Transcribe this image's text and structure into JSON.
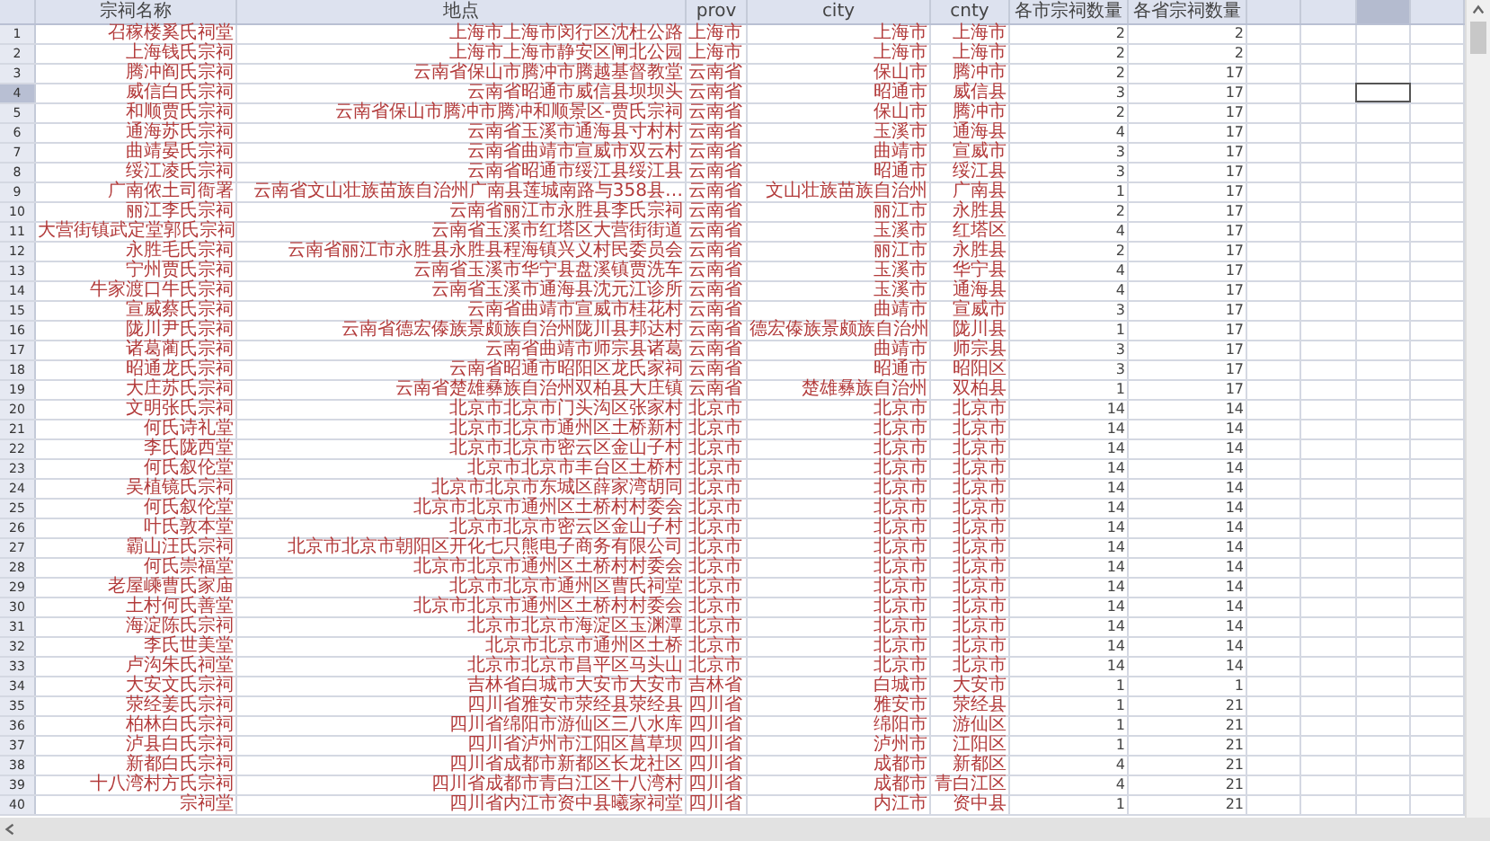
{
  "columns": [
    "宗祠名称",
    "地点",
    "prov",
    "city",
    "cnty",
    "各市宗祠数量",
    "各省宗祠数量"
  ],
  "empty_columns": [
    {
      "selected": false
    },
    {
      "selected": false
    },
    {
      "selected": true
    },
    {
      "selected": false
    }
  ],
  "rows": [
    {
      "number": "1",
      "selected": false,
      "cells": [
        "召稼楼奚氏祠堂",
        "上海市上海市闵行区沈杜公路",
        "上海市",
        "上海市",
        "上海市",
        "2",
        "2"
      ]
    },
    {
      "number": "2",
      "selected": false,
      "cells": [
        "上海钱氏宗祠",
        "上海市上海市静安区闸北公园",
        "上海市",
        "上海市",
        "上海市",
        "2",
        "2"
      ]
    },
    {
      "number": "3",
      "selected": false,
      "cells": [
        "腾冲阎氏宗祠",
        "云南省保山市腾冲市腾越基督教堂",
        "云南省",
        "保山市",
        "腾冲市",
        "2",
        "17"
      ]
    },
    {
      "number": "4",
      "selected": true,
      "cells": [
        "威信白氏宗祠",
        "云南省昭通市威信县坝坝头",
        "云南省",
        "昭通市",
        "威信县",
        "3",
        "17"
      ]
    },
    {
      "number": "5",
      "selected": false,
      "cells": [
        "和顺贾氏宗祠",
        "云南省保山市腾冲市腾冲和顺景区-贾氏宗祠",
        "云南省",
        "保山市",
        "腾冲市",
        "2",
        "17"
      ]
    },
    {
      "number": "6",
      "selected": false,
      "cells": [
        "通海苏氏宗祠",
        "云南省玉溪市通海县寸村村",
        "云南省",
        "玉溪市",
        "通海县",
        "4",
        "17"
      ]
    },
    {
      "number": "7",
      "selected": false,
      "cells": [
        "曲靖晏氏宗祠",
        "云南省曲靖市宣威市双云村",
        "云南省",
        "曲靖市",
        "宣威市",
        "3",
        "17"
      ]
    },
    {
      "number": "8",
      "selected": false,
      "cells": [
        "绥江凌氏宗祠",
        "云南省昭通市绥江县绥江县",
        "云南省",
        "昭通市",
        "绥江县",
        "3",
        "17"
      ]
    },
    {
      "number": "9",
      "selected": false,
      "cells": [
        "广南侬土司衙署",
        "云南省文山壮族苗族自治州广南县莲城南路与358县…",
        "云南省",
        "文山壮族苗族自治州",
        "广南县",
        "1",
        "17"
      ]
    },
    {
      "number": "10",
      "selected": false,
      "cells": [
        "丽江李氏宗祠",
        "云南省丽江市永胜县李氏宗祠",
        "云南省",
        "丽江市",
        "永胜县",
        "2",
        "17"
      ]
    },
    {
      "number": "11",
      "selected": false,
      "cells": [
        "大营街镇武定堂郭氏宗祠",
        "云南省玉溪市红塔区大营街街道",
        "云南省",
        "玉溪市",
        "红塔区",
        "4",
        "17"
      ]
    },
    {
      "number": "12",
      "selected": false,
      "cells": [
        "永胜毛氏宗祠",
        "云南省丽江市永胜县永胜县程海镇兴义村民委员会",
        "云南省",
        "丽江市",
        "永胜县",
        "2",
        "17"
      ]
    },
    {
      "number": "13",
      "selected": false,
      "cells": [
        "宁州贾氏宗祠",
        "云南省玉溪市华宁县盘溪镇贾洗车",
        "云南省",
        "玉溪市",
        "华宁县",
        "4",
        "17"
      ]
    },
    {
      "number": "14",
      "selected": false,
      "cells": [
        "牛家渡口牛氏宗祠",
        "云南省玉溪市通海县沈元江诊所",
        "云南省",
        "玉溪市",
        "通海县",
        "4",
        "17"
      ]
    },
    {
      "number": "15",
      "selected": false,
      "cells": [
        "宣威蔡氏宗祠",
        "云南省曲靖市宣威市桂花村",
        "云南省",
        "曲靖市",
        "宣威市",
        "3",
        "17"
      ]
    },
    {
      "number": "16",
      "selected": false,
      "cells": [
        "陇川尹氏宗祠",
        "云南省德宏傣族景颇族自治州陇川县邦达村",
        "云南省",
        "德宏傣族景颇族自治州",
        "陇川县",
        "1",
        "17"
      ]
    },
    {
      "number": "17",
      "selected": false,
      "cells": [
        "诸葛蔺氏宗祠",
        "云南省曲靖市师宗县诸葛",
        "云南省",
        "曲靖市",
        "师宗县",
        "3",
        "17"
      ]
    },
    {
      "number": "18",
      "selected": false,
      "cells": [
        "昭通龙氏宗祠",
        "云南省昭通市昭阳区龙氏家祠",
        "云南省",
        "昭通市",
        "昭阳区",
        "3",
        "17"
      ]
    },
    {
      "number": "19",
      "selected": false,
      "cells": [
        "大庄苏氏宗祠",
        "云南省楚雄彝族自治州双柏县大庄镇",
        "云南省",
        "楚雄彝族自治州",
        "双柏县",
        "1",
        "17"
      ]
    },
    {
      "number": "20",
      "selected": false,
      "cells": [
        "文明张氏宗祠",
        "北京市北京市门头沟区张家村",
        "北京市",
        "北京市",
        "北京市",
        "14",
        "14"
      ]
    },
    {
      "number": "21",
      "selected": false,
      "cells": [
        "何氏诗礼堂",
        "北京市北京市通州区土桥新村",
        "北京市",
        "北京市",
        "北京市",
        "14",
        "14"
      ]
    },
    {
      "number": "22",
      "selected": false,
      "cells": [
        "李氏陇西堂",
        "北京市北京市密云区金山子村",
        "北京市",
        "北京市",
        "北京市",
        "14",
        "14"
      ]
    },
    {
      "number": "23",
      "selected": false,
      "cells": [
        "何氏叙伦堂",
        "北京市北京市丰台区土桥村",
        "北京市",
        "北京市",
        "北京市",
        "14",
        "14"
      ]
    },
    {
      "number": "24",
      "selected": false,
      "cells": [
        "吴植镜氏宗祠",
        "北京市北京市东城区薛家湾胡同",
        "北京市",
        "北京市",
        "北京市",
        "14",
        "14"
      ]
    },
    {
      "number": "25",
      "selected": false,
      "cells": [
        "何氏叙伦堂",
        "北京市北京市通州区土桥村村委会",
        "北京市",
        "北京市",
        "北京市",
        "14",
        "14"
      ]
    },
    {
      "number": "26",
      "selected": false,
      "cells": [
        "叶氏敦本堂",
        "北京市北京市密云区金山子村",
        "北京市",
        "北京市",
        "北京市",
        "14",
        "14"
      ]
    },
    {
      "number": "27",
      "selected": false,
      "cells": [
        "霸山汪氏宗祠",
        "北京市北京市朝阳区开化七只熊电子商务有限公司",
        "北京市",
        "北京市",
        "北京市",
        "14",
        "14"
      ]
    },
    {
      "number": "28",
      "selected": false,
      "cells": [
        "何氏崇福堂",
        "北京市北京市通州区土桥村村委会",
        "北京市",
        "北京市",
        "北京市",
        "14",
        "14"
      ]
    },
    {
      "number": "29",
      "selected": false,
      "cells": [
        "老屋嵊曹氏家庙",
        "北京市北京市通州区曹氏祠堂",
        "北京市",
        "北京市",
        "北京市",
        "14",
        "14"
      ]
    },
    {
      "number": "30",
      "selected": false,
      "cells": [
        "土村何氏善堂",
        "北京市北京市通州区土桥村村委会",
        "北京市",
        "北京市",
        "北京市",
        "14",
        "14"
      ]
    },
    {
      "number": "31",
      "selected": false,
      "cells": [
        "海淀陈氏宗祠",
        "北京市北京市海淀区玉渊潭",
        "北京市",
        "北京市",
        "北京市",
        "14",
        "14"
      ]
    },
    {
      "number": "32",
      "selected": false,
      "cells": [
        "李氏世美堂",
        "北京市北京市通州区土桥",
        "北京市",
        "北京市",
        "北京市",
        "14",
        "14"
      ]
    },
    {
      "number": "33",
      "selected": false,
      "cells": [
        "卢沟朱氏祠堂",
        "北京市北京市昌平区马头山",
        "北京市",
        "北京市",
        "北京市",
        "14",
        "14"
      ]
    },
    {
      "number": "34",
      "selected": false,
      "cells": [
        "大安文氏宗祠",
        "吉林省白城市大安市大安市",
        "吉林省",
        "白城市",
        "大安市",
        "1",
        "1"
      ]
    },
    {
      "number": "35",
      "selected": false,
      "cells": [
        "荥经姜氏宗祠",
        "四川省雅安市荥经县荥经县",
        "四川省",
        "雅安市",
        "荥经县",
        "1",
        "21"
      ]
    },
    {
      "number": "36",
      "selected": false,
      "cells": [
        "柏林白氏宗祠",
        "四川省绵阳市游仙区三八水库",
        "四川省",
        "绵阳市",
        "游仙区",
        "1",
        "21"
      ]
    },
    {
      "number": "37",
      "selected": false,
      "cells": [
        "泸县白氏宗祠",
        "四川省泸州市江阳区菖草坝",
        "四川省",
        "泸州市",
        "江阳区",
        "1",
        "21"
      ]
    },
    {
      "number": "38",
      "selected": false,
      "cells": [
        "新都白氏宗祠",
        "四川省成都市新都区长龙社区",
        "四川省",
        "成都市",
        "新都区",
        "4",
        "21"
      ]
    },
    {
      "number": "39",
      "selected": false,
      "cells": [
        "十八湾村方氏宗祠",
        "四川省成都市青白江区十八湾村",
        "四川省",
        "成都市",
        "青白江区",
        "4",
        "21"
      ]
    },
    {
      "number": "40",
      "selected": false,
      "cells": [
        "宗祠堂",
        "四川省内江市资中县曦家祠堂",
        "四川省",
        "内江市",
        "资中县",
        "1",
        "21"
      ]
    }
  ]
}
